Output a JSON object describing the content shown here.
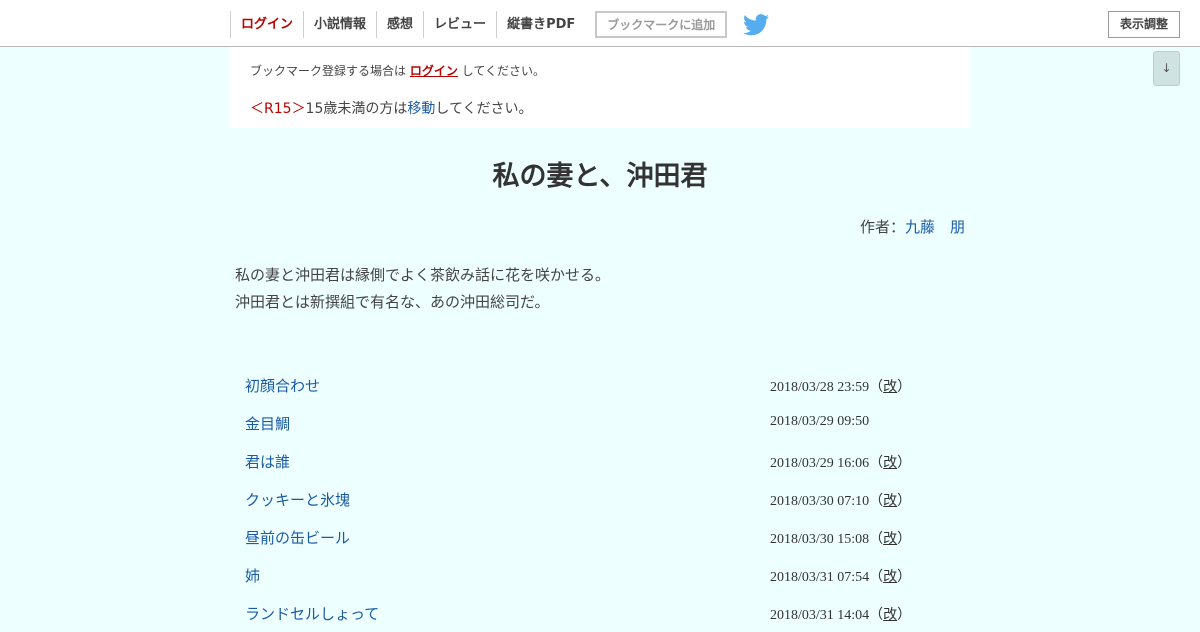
{
  "header": {
    "nav": [
      {
        "label": "ログイン",
        "name": "nav-login"
      },
      {
        "label": "小説情報",
        "name": "nav-novel-info"
      },
      {
        "label": "感想",
        "name": "nav-impressions"
      },
      {
        "label": "レビュー",
        "name": "nav-review"
      },
      {
        "label": "縦書きPDF",
        "name": "nav-vertical-pdf"
      }
    ],
    "bookmark_button": "ブックマークに追加",
    "twitter_icon": "twitter-bird-icon",
    "display_settings": "表示調整",
    "scroll_down": "↓"
  },
  "notice": {
    "bookmark_prefix": "ブックマーク登録する場合は",
    "bookmark_login": "ログイン",
    "bookmark_suffix": "してください。",
    "r15_tag": "＜R15＞",
    "age_prefix": "15歳未満の方は",
    "age_link": "移動",
    "age_suffix": "してください。"
  },
  "novel": {
    "title": "私の妻と、沖田君",
    "author_label": "作者：",
    "author": "九藤　朋",
    "synopsis": [
      "私の妻と沖田君は縁側でよく茶飲み話に花を咲かせる。",
      "沖田君とは新撰組で有名な、あの沖田総司だ。"
    ]
  },
  "chapters": [
    {
      "title": "初顔合わせ",
      "date": "2018/03/28 23:59",
      "revised": true
    },
    {
      "title": "金目鯛",
      "date": "2018/03/29 09:50",
      "revised": false
    },
    {
      "title": "君は誰",
      "date": "2018/03/29 16:06",
      "revised": true
    },
    {
      "title": "クッキーと氷塊",
      "date": "2018/03/30 07:10",
      "revised": true
    },
    {
      "title": "昼前の缶ビール",
      "date": "2018/03/30 15:08",
      "revised": true
    },
    {
      "title": "姉",
      "date": "2018/03/31 07:54",
      "revised": true
    },
    {
      "title": "ランドセルしょって",
      "date": "2018/03/31 14:04",
      "revised": true
    }
  ],
  "revised_label": "改",
  "colors": {
    "background": "#eeffff",
    "link": "#1a5ba6",
    "login_red": "#bb0000"
  }
}
